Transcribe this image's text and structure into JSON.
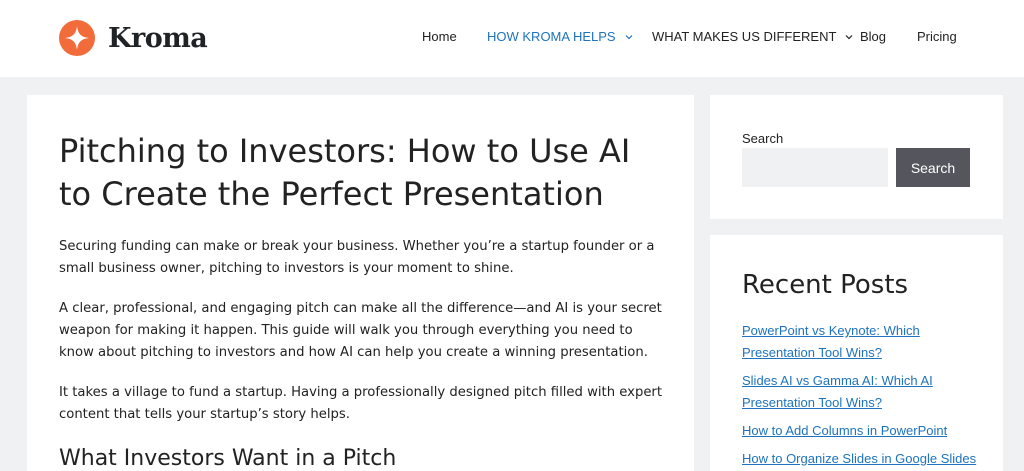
{
  "brand": {
    "name": "Kroma",
    "accent": "#f26b3a"
  },
  "nav": {
    "home": "Home",
    "how": "HOW KROMA HELPS",
    "different": "WHAT MAKES US DIFFERENT",
    "blog": "Blog",
    "pricing": "Pricing",
    "active_color": "#1e73be"
  },
  "article": {
    "title": "Pitching to Investors: How to Use AI to Create the Perfect Presentation",
    "paragraphs": [
      "Securing funding can make or break your business. Whether you’re a startup founder or a small business owner, pitching to investors is your moment to shine.",
      "A clear, professional, and engaging pitch can make all the difference—and AI is your secret weapon for making it happen. This guide will walk you through everything you need to know about pitching to investors and how AI can help you create a winning presentation.",
      "It takes a village to fund a startup. Having a professionally designed pitch filled with expert content that tells your startup’s story helps."
    ],
    "subheading": "What Investors Want in a Pitch"
  },
  "sidebar": {
    "search": {
      "label": "Search",
      "placeholder": "",
      "button": "Search"
    },
    "recent": {
      "title": "Recent Posts",
      "posts": [
        "PowerPoint vs Keynote: Which Presentation Tool Wins?",
        "Slides AI vs Gamma AI: Which AI Presentation Tool Wins?",
        "How to Add Columns in PowerPoint",
        "How to Organize Slides in Google Slides"
      ]
    }
  }
}
